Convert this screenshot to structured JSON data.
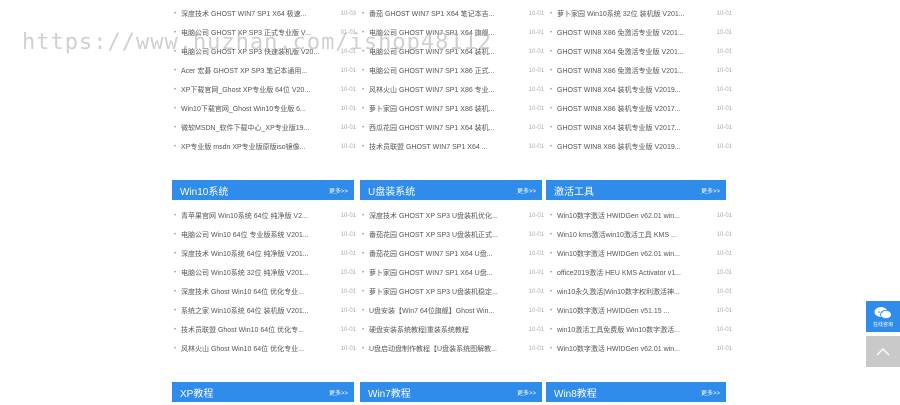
{
  "watermark": "https://www.huzhan.com/ishop48112",
  "top_lists": [
    [
      {
        "t": "深度技术 GHOST WIN7 SP1 X64 极速...",
        "d": "10-03"
      },
      {
        "t": "电脑公司 GHOST XP SP3 正式专业版 V...",
        "d": "01-01"
      },
      {
        "t": "电脑公司 GHOST XP SP3 快速装机版 V20...",
        "d": "10-01"
      },
      {
        "t": "Acer 宏碁 GHOST XP SP3 笔记本通用...",
        "d": "10-01"
      },
      {
        "t": "XP下载官网_Ghost XP专业版 64位 V20...",
        "d": "10-01"
      },
      {
        "t": "Win10下载官网_Ghost Win10专业版 6...",
        "d": "10-01"
      },
      {
        "t": "微软MSDN_软件下载中心_XP专业版19...",
        "d": "10-01"
      },
      {
        "t": "XP专业版 msdn XP专业版原版iso镜像...",
        "d": "10-01"
      }
    ],
    [
      {
        "t": "番茄 GHOST WIN7 SP1 X64 笔记本吉...",
        "d": "10-01"
      },
      {
        "t": "电脑公司 GHOST WIN7 SP1 X64 旗舰...",
        "d": "10-01"
      },
      {
        "t": "电脑公司 GHOST WIN7 SP1 X64 装机...",
        "d": "10-01"
      },
      {
        "t": "电脑公司 GHOST WIN7 SP1 X86 正式...",
        "d": "10-01"
      },
      {
        "t": "风林火山 GHOST WIN7 SP1 X86 专业...",
        "d": "10-01"
      },
      {
        "t": "萝卜家园 GHOST WIN7 SP1 X86 装机...",
        "d": "10-01"
      },
      {
        "t": "西瓜花园 GHOST WIN7 SP1 X64 装机...",
        "d": "10-01"
      },
      {
        "t": "技术员联盟 GHOST WIN7 SP1 X64 ...",
        "d": "10-01"
      }
    ],
    [
      {
        "t": "萝卜家园 Win10系统 32位 装机版 V201...",
        "d": "10-01"
      },
      {
        "t": "GHOST WIN8 X86 免激活专业版 V201...",
        "d": "10-01"
      },
      {
        "t": "GHOST WIN8 X64 免激活专业版 V201...",
        "d": "10-01"
      },
      {
        "t": "GHOST WIN8 X86 免激活专业版 V201...",
        "d": "10-01"
      },
      {
        "t": "GHOST WIN8 X64 装机专业版 V2019...",
        "d": "10-01"
      },
      {
        "t": "GHOST WIN8 X86 装机专业版 V2017...",
        "d": "10-01"
      },
      {
        "t": "GHOST WIN8 X64 装机专业版 V2017...",
        "d": "10-01"
      },
      {
        "t": "GHOST WIN8 X86 装机专业版 V2019...",
        "d": "10-01"
      }
    ]
  ],
  "mid_sections": [
    {
      "title": "Win10系统",
      "more": "更多>>",
      "items": [
        {
          "t": "青苹果官网 Win10系统 64位 纯净版 V2...",
          "d": "10-01"
        },
        {
          "t": "电脑公司 Win10 64位 专业版系统 V201...",
          "d": "10-01"
        },
        {
          "t": "深度技术 Win10系统 64位 纯净版 V201...",
          "d": "10-01"
        },
        {
          "t": "电脑公司 Win10系统 32位 纯净版 V201...",
          "d": "10-01"
        },
        {
          "t": "深度技术 Ghost Win10 64位 优化专业...",
          "d": "10-01"
        },
        {
          "t": "系统之家 Win10系统 64位 装机版 V201...",
          "d": "10-01"
        },
        {
          "t": "技术员联盟 Ghost Win10 64位 优化专...",
          "d": "10-01"
        },
        {
          "t": "风林火山 Ghost Win10 64位 优化专业...",
          "d": "10-01"
        }
      ]
    },
    {
      "title": "U盘装系统",
      "more": "更多>>",
      "items": [
        {
          "t": "深度技术 GHOST XP SP3 U盘装机优化...",
          "d": "10-01"
        },
        {
          "t": "番茄花园 GHOST XP SP3 U盘装机正式...",
          "d": "10-01"
        },
        {
          "t": "番茄花园 GHOST WIN7 SP1 X64 U盘...",
          "d": "10-01"
        },
        {
          "t": "萝卜家园 GHOST WIN7 SP1 X64 U盘...",
          "d": "10-01"
        },
        {
          "t": "萝卜家园 GHOST XP SP3 U盘装机稳定...",
          "d": "10-01"
        },
        {
          "t": "U盘安装【Win7 64位旗舰】Ghost Win...",
          "d": "10-01"
        },
        {
          "t": "硬盘安装系统教程|重装系统教程",
          "d": "10-01"
        },
        {
          "t": "U盘启动盘制作教程【U盘装系统图解教...",
          "d": "10-01"
        }
      ]
    },
    {
      "title": "激活工具",
      "more": "更多>>",
      "items": [
        {
          "t": "Win10数字激活 HWIDGen v62.01 win...",
          "d": "10-01"
        },
        {
          "t": "Win10 kms激活win10激活工具 KMS ...",
          "d": "10-01"
        },
        {
          "t": "Win10数字激活 HWIDGen v62.01 win...",
          "d": "10-01"
        },
        {
          "t": "office2019激活 HEU KMS Activator v1...",
          "d": "10-01"
        },
        {
          "t": "win10永久激活|Win10数字权利激活神...",
          "d": "10-01"
        },
        {
          "t": "Win10数字激活 HWIDGen v51.15 ...",
          "d": "10-01"
        },
        {
          "t": "win10激活工具免费版 Win10数字激活...",
          "d": "10-01"
        },
        {
          "t": "Win10数字激活 HWIDGen v62.01 win...",
          "d": "10-01"
        }
      ]
    }
  ],
  "bottom_sections": [
    {
      "title": "XP教程",
      "more": "更多>>"
    },
    {
      "title": "Win7教程",
      "more": "更多>>"
    },
    {
      "title": "Win8教程",
      "more": "更多>>"
    }
  ],
  "side": {
    "chat_label": "在线咨询"
  }
}
